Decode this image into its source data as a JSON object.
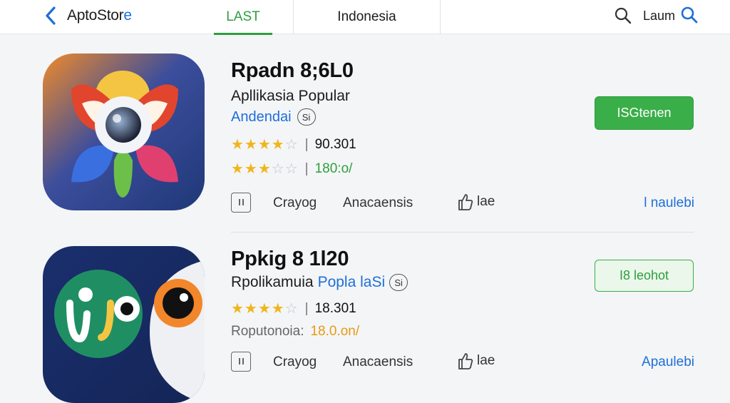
{
  "header": {
    "brand_main": "AptoStor",
    "brand_accent": "e",
    "tabs": [
      {
        "label": "LAST"
      },
      {
        "label": "Indonesia"
      }
    ],
    "login_label": "Laum",
    "icons": [
      "chevron-left-icon",
      "search-icon",
      "search-icon"
    ]
  },
  "apps": [
    {
      "title": "Rpadn 8;6L0",
      "subtitle": "Apllikasia Popular",
      "developer": "Andendai",
      "badge": "Si",
      "rating1": {
        "stars": 4.5,
        "value": "90.301"
      },
      "rating2": {
        "stars": 3,
        "value": "180:o/"
      },
      "button_label": "ISGtenen",
      "actions": {
        "a1": "Crayog",
        "a2": "Anacaensis",
        "a3": "lae",
        "more": "l naulebi"
      }
    },
    {
      "title": "Ppkig 8 1l20",
      "subtitle_plain": "Rpolikamuia ",
      "subtitle_accent": "Popla laSi",
      "badge": "Si",
      "rating1": {
        "stars": 4.5,
        "value": "18.301"
      },
      "rating2_label": "Roputonoia:",
      "rating2_value": "18.0.on/",
      "button_label": "I8 leohot",
      "actions": {
        "a1": "Crayog",
        "a2": "Anacaensis",
        "a3": "lae",
        "more": "Apaulebi"
      }
    }
  ],
  "colors": {
    "accent_green": "#3aae49",
    "accent_blue": "#1e6fd9",
    "star": "#f1b51c"
  }
}
